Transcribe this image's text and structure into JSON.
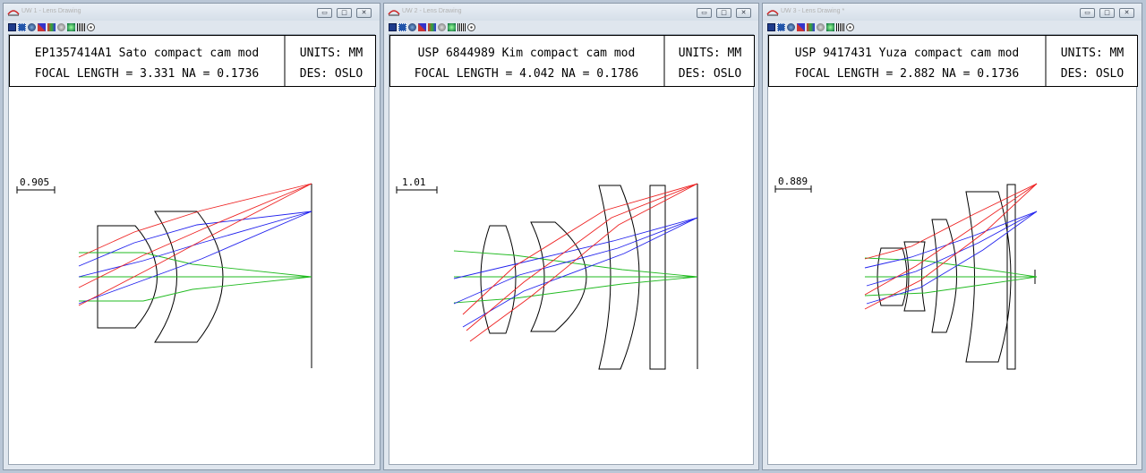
{
  "windows": [
    {
      "title": "UW 1 - Lens Drawing",
      "header": {
        "title": "EP1357414A1 Sato compact cam mod",
        "focal": "FOCAL LENGTH = 3.331  NA = 0.1736",
        "units": "UNITS: MM",
        "des": "DES: OSLO"
      },
      "scale_label": "0.905"
    },
    {
      "title": "UW 2 - Lens Drawing",
      "header": {
        "title": "USP 6844989 Kim compact cam mod",
        "focal": "FOCAL LENGTH = 4.042  NA = 0.1786",
        "units": "UNITS: MM",
        "des": "DES: OSLO"
      },
      "scale_label": "1.01"
    },
    {
      "title": "UW 3 - Lens Drawing *",
      "header": {
        "title": "USP 9417431 Yuza compact cam mod",
        "focal": "FOCAL LENGTH = 2.882  NA = 0.1736",
        "units": "UNITS: MM",
        "des": "DES: OSLO"
      },
      "scale_label": "0.889"
    }
  ],
  "window_controls": {
    "minimize": "▭",
    "maximize": "□",
    "close": "✕"
  },
  "colors": {
    "ray_axial": "#22bb22",
    "ray_mid": "#2222ee",
    "ray_edge": "#ee2222",
    "lens_outline": "#000000"
  },
  "toolbar_icons": [
    "lens-icon",
    "grid-icon",
    "spot-icon",
    "ray-fan-icon",
    "color-icon",
    "sphere-icon",
    "wave-icon",
    "bars-icon",
    "target-icon"
  ]
}
